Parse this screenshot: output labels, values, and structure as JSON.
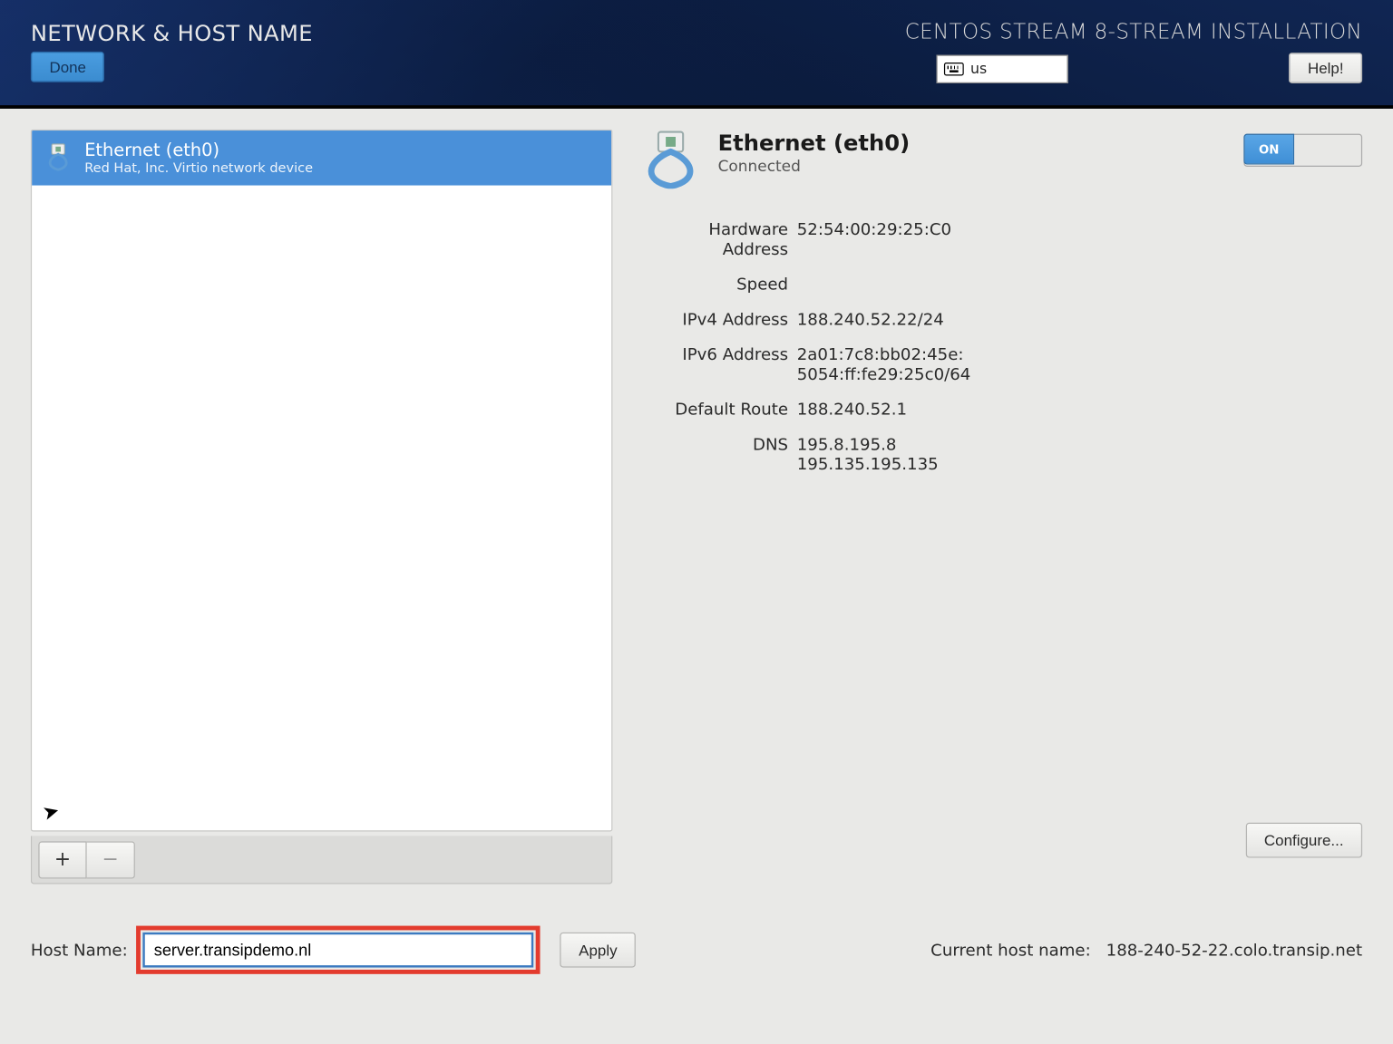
{
  "header": {
    "title": "NETWORK & HOST NAME",
    "subtitle": "CENTOS STREAM 8-STREAM INSTALLATION",
    "done_label": "Done",
    "help_label": "Help!",
    "keyboard_layout": "us"
  },
  "device_list": {
    "items": [
      {
        "name": "Ethernet (eth0)",
        "subtitle": "Red Hat, Inc. Virtio network device"
      }
    ],
    "add_label": "+",
    "remove_label": "−"
  },
  "connection": {
    "name": "Ethernet (eth0)",
    "status": "Connected",
    "toggle_on_label": "ON",
    "details": {
      "hardware_address_label": "Hardware Address",
      "hardware_address": "52:54:00:29:25:C0",
      "speed_label": "Speed",
      "speed": "",
      "ipv4_label": "IPv4 Address",
      "ipv4": "188.240.52.22/24",
      "ipv6_label": "IPv6 Address",
      "ipv6": "2a01:7c8:bb02:45e:\n5054:ff:fe29:25c0/64",
      "route_label": "Default Route",
      "route": "188.240.52.1",
      "dns_label": "DNS",
      "dns": "195.8.195.8\n195.135.195.135"
    },
    "configure_label": "Configure..."
  },
  "hostname": {
    "label": "Host Name:",
    "value": "server.transipdemo.nl",
    "apply_label": "Apply",
    "current_label": "Current host name:",
    "current_value": "188-240-52-22.colo.transip.net"
  }
}
